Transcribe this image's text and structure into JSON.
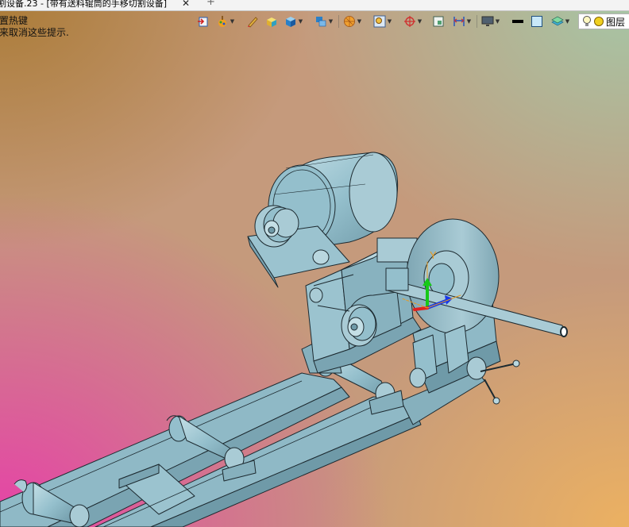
{
  "tab": {
    "title": "割设备.23 - [带有送料辊筒的手移切割设备]",
    "close_glyph": "✕",
    "add_glyph": "+"
  },
  "hint_lines": [
    "置热键",
    "来取消这些提示."
  ],
  "toolbar": {
    "icons": [
      "import-icon",
      "paint-icon",
      "sketch-pencil-icon",
      "solid-box-icon",
      "cube-icon",
      "part-stack-icon",
      "sphere-icon",
      "zoom-frame-icon",
      "snap-icon",
      "view-box-icon",
      "dimension-icon",
      "monitor-icon",
      "line-style-icon",
      "color-square-icon",
      "layer-plane-icon"
    ],
    "layers_label": "图层"
  },
  "axes": {
    "y_label": "Y"
  },
  "colors": {
    "model_fill": "#94bfcc",
    "model_light": "#b9d7df",
    "model_dark": "#6f9aa8",
    "edge": "#1d2a30",
    "axis_x": "#e02020",
    "axis_y": "#18c818",
    "axis_z": "#1838e8",
    "axis_label": "#e89a20"
  }
}
